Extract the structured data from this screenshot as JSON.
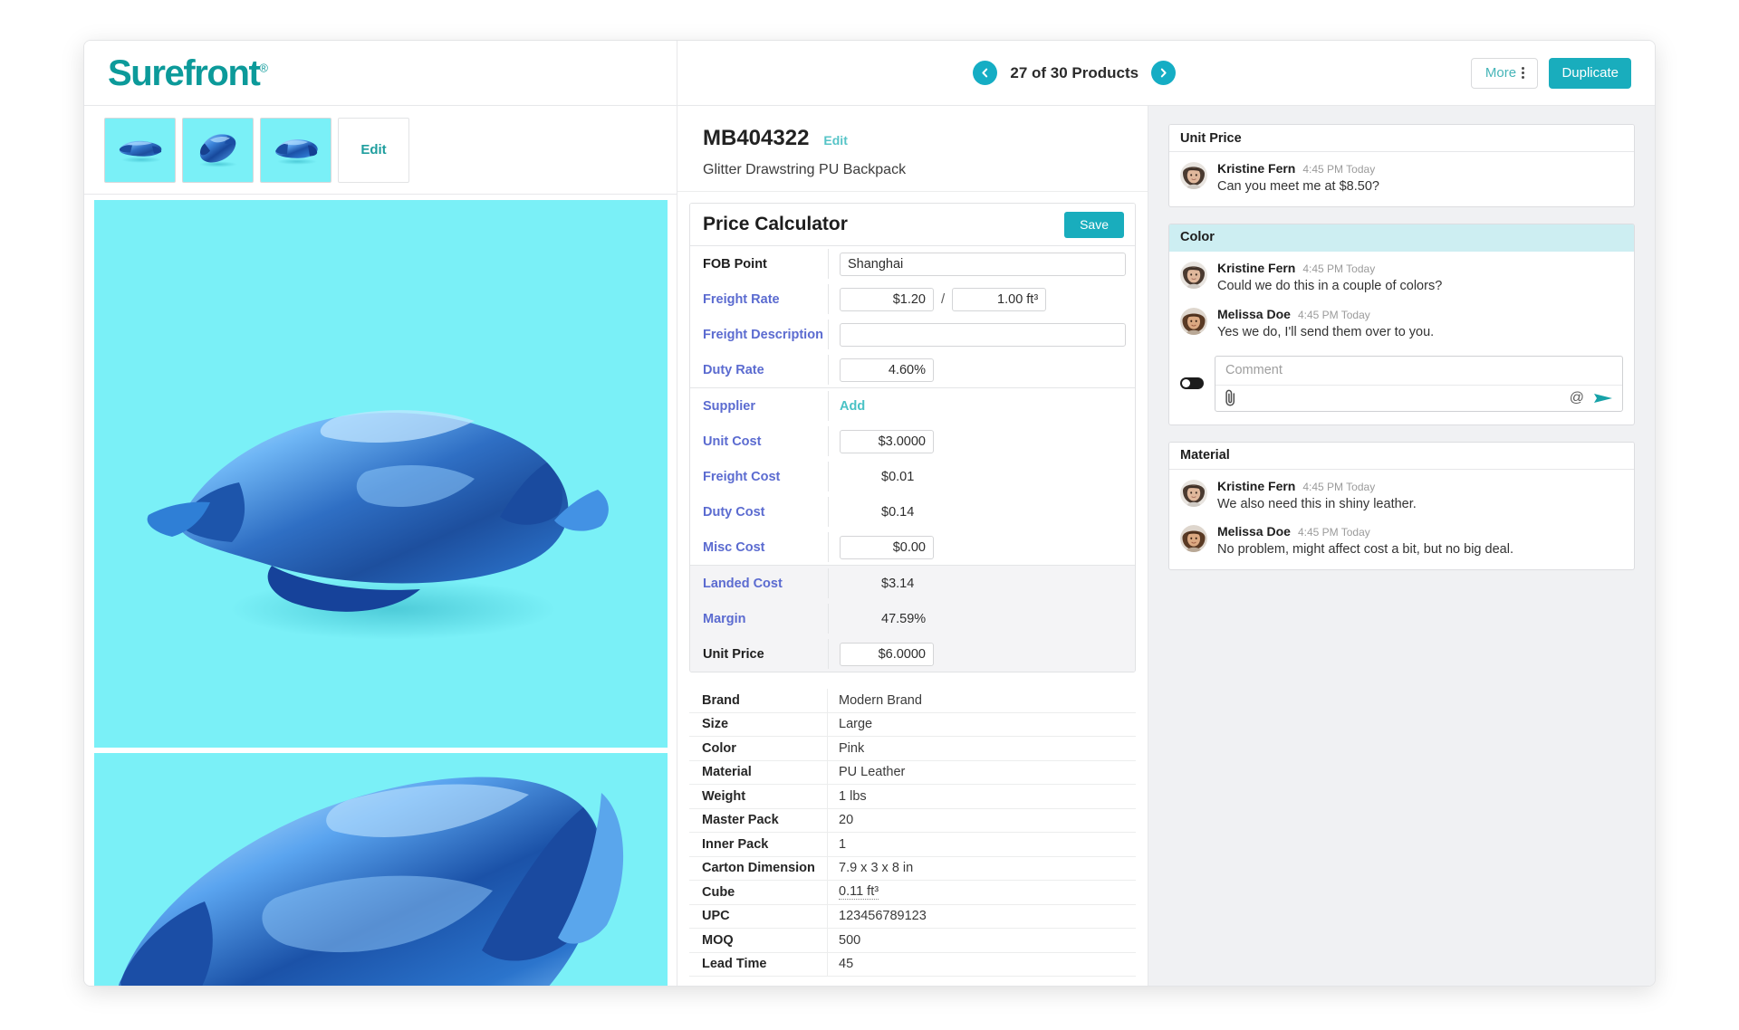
{
  "app": {
    "brand_name": "Surefront",
    "brand_registered": "®",
    "brand_color": "#0c9a9a"
  },
  "topbar": {
    "prev_icon": "chevron-left-icon",
    "next_icon": "chevron-right-icon",
    "pager_text": "27 of 30 Products",
    "more_label": "More",
    "more_icon": "kebab-menu-icon",
    "duplicate_label": "Duplicate",
    "accent_color": "#19adbd"
  },
  "gallery": {
    "thumbnails": [
      {
        "name": "product-thumbnail-1",
        "alt": "Blue metallic bag front view"
      },
      {
        "name": "product-thumbnail-2",
        "alt": "Blue metallic bag angled view"
      },
      {
        "name": "product-thumbnail-3",
        "alt": "Blue metallic bag three-quarter view"
      }
    ],
    "edit_label": "Edit",
    "background_color": "#7af0f7",
    "hero_alt": "Glitter drawstring PU backpack, blue metallic",
    "hero2_alt": "Glitter drawstring PU backpack close-up"
  },
  "product": {
    "sku": "MB404322",
    "edit_label": "Edit",
    "name": "Glitter Drawstring PU Backpack"
  },
  "price_calculator": {
    "title": "Price Calculator",
    "save_label": "Save",
    "rows": [
      {
        "label": "FOB Point",
        "label_style": "dark",
        "type": "input-full",
        "value": "Shanghai"
      },
      {
        "label": "Freight Rate",
        "label_style": "link",
        "type": "input-pair",
        "value": "$1.20",
        "separator": "/",
        "value2": "1.00 ft³"
      },
      {
        "label": "Freight Description",
        "label_style": "link",
        "type": "input-full",
        "value": ""
      },
      {
        "label": "Duty Rate",
        "label_style": "link",
        "type": "input-sm",
        "value": "4.60%"
      }
    ],
    "rows2": [
      {
        "label": "Supplier",
        "label_style": "link",
        "type": "link",
        "value": "Add"
      },
      {
        "label": "Unit Cost",
        "label_style": "link",
        "type": "input-sm",
        "value": "$3.0000"
      },
      {
        "label": "Freight Cost",
        "label_style": "link",
        "type": "text",
        "value": "$0.01"
      },
      {
        "label": "Duty Cost",
        "label_style": "link",
        "type": "text",
        "value": "$0.14"
      },
      {
        "label": "Misc Cost",
        "label_style": "link",
        "type": "input-sm",
        "value": "$0.00"
      }
    ],
    "rows3": [
      {
        "label": "Landed Cost",
        "label_style": "link",
        "type": "text",
        "value": "$3.14"
      },
      {
        "label": "Margin",
        "label_style": "link",
        "type": "text",
        "value": "47.59%"
      },
      {
        "label": "Unit Price",
        "label_style": "dark",
        "type": "input-sm",
        "value": "$6.0000"
      }
    ]
  },
  "attributes": [
    {
      "label": "Brand",
      "value": "Modern Brand"
    },
    {
      "label": "Size",
      "value": "Large"
    },
    {
      "label": "Color",
      "value": "Pink"
    },
    {
      "label": "Material",
      "value": "PU Leather"
    },
    {
      "label": "Weight",
      "value": "1 lbs"
    },
    {
      "label": "Master Pack",
      "value": "20"
    },
    {
      "label": "Inner Pack",
      "value": "1"
    },
    {
      "label": "Carton Dimension",
      "value": "7.9 x 3 x 8 in"
    },
    {
      "label": "Cube",
      "value": "0.11 ft³",
      "underline": true
    },
    {
      "label": "UPC",
      "value": "123456789123"
    },
    {
      "label": "MOQ",
      "value": "500"
    },
    {
      "label": "Lead Time",
      "value": "45"
    }
  ],
  "comments": {
    "threads": [
      {
        "title": "Unit Price",
        "active": false,
        "messages": [
          {
            "author": "Kristine Fern",
            "time": "4:45 PM Today",
            "text": "Can you meet me at $8.50?",
            "avatar": "kristine"
          }
        ],
        "composer": false
      },
      {
        "title": "Color",
        "active": true,
        "messages": [
          {
            "author": "Kristine Fern",
            "time": "4:45 PM Today",
            "text": "Could we do this in a couple of colors?",
            "avatar": "kristine"
          },
          {
            "author": "Melissa Doe",
            "time": "4:45 PM Today",
            "text": "Yes we do, I'll send them over to you.",
            "avatar": "melissa"
          }
        ],
        "composer": true
      },
      {
        "title": "Material",
        "active": false,
        "messages": [
          {
            "author": "Kristine Fern",
            "time": "4:45 PM Today",
            "text": "We also need this in shiny leather.",
            "avatar": "kristine"
          },
          {
            "author": "Melissa Doe",
            "time": "4:45 PM Today",
            "text": "No problem, might affect cost a bit, but no big deal.",
            "avatar": "melissa"
          }
        ],
        "composer": false
      }
    ],
    "composer": {
      "placeholder": "Comment",
      "attach_icon": "paperclip-icon",
      "mention_icon": "at-mention-icon",
      "send_icon": "send-icon",
      "toggle_name": "internal-external-toggle",
      "send_color": "#17a2a8"
    }
  }
}
